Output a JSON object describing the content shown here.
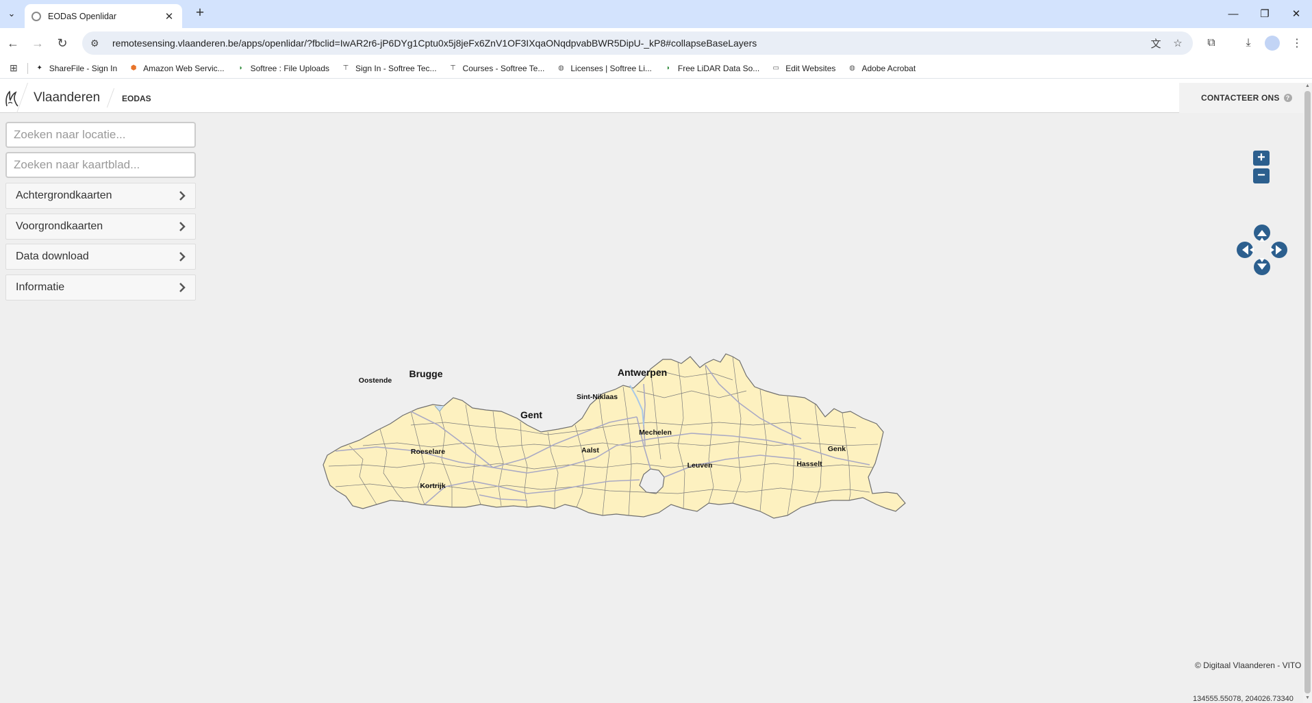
{
  "browser": {
    "tab_title": "EODaS Openlidar",
    "url_host": "remotesensing.vlaanderen.be",
    "url_path": "/apps/openlidar/?fbclid=IwAR2r6-jP6DYg1Cptu0x5j8jeFx6ZnV1OF3IXqaONqdpvabBWR5DipU-_kP8#collapseBaseLayers",
    "bookmarks": [
      {
        "label": "ShareFile - Sign In",
        "icon": "sharefile-icon",
        "color": "#222222"
      },
      {
        "label": "Amazon Web Servic...",
        "icon": "aws-icon",
        "color": "#e8742a"
      },
      {
        "label": "Softree : File Uploads",
        "icon": "softree-icon",
        "color": "#2e8b3a"
      },
      {
        "label": "Sign In - Softree Tec...",
        "icon": "softree-t-icon",
        "color": "#333333"
      },
      {
        "label": "Courses - Softree Te...",
        "icon": "softree-t-icon",
        "color": "#333333"
      },
      {
        "label": "Licenses | Softree Li...",
        "icon": "globe-icon",
        "color": "#555555"
      },
      {
        "label": "Free LiDAR Data So...",
        "icon": "softree-icon",
        "color": "#2e8b3a"
      },
      {
        "label": "Edit Websites",
        "icon": "folder-icon",
        "color": "#555555"
      },
      {
        "label": "Adobe Acrobat",
        "icon": "globe-icon",
        "color": "#555555"
      }
    ]
  },
  "header": {
    "brand": "Vlaanderen",
    "app": "EODAS",
    "contact": "CONTACTEER ONS",
    "help": "?"
  },
  "sidebar": {
    "search_location_placeholder": "Zoeken naar locatie...",
    "search_sheet_placeholder": "Zoeken naar kaartblad...",
    "items": [
      {
        "label": "Achtergrondkaarten"
      },
      {
        "label": "Voorgrondkaarten"
      },
      {
        "label": "Data download"
      },
      {
        "label": "Informatie"
      }
    ]
  },
  "map": {
    "zoom_in": "+",
    "zoom_out": "−",
    "attribution": "© Digitaal Vlaanderen - VITO",
    "coordinates": "134555.55078, 204026.73340",
    "cities": [
      {
        "name": "Brugge",
        "major": true
      },
      {
        "name": "Oostende",
        "major": false
      },
      {
        "name": "Antwerpen",
        "major": true
      },
      {
        "name": "Sint-Niklaas",
        "major": false
      },
      {
        "name": "Gent",
        "major": true
      },
      {
        "name": "Mechelen",
        "major": false
      },
      {
        "name": "Genk",
        "major": false
      },
      {
        "name": "Roeselare",
        "major": false
      },
      {
        "name": "Aalst",
        "major": false
      },
      {
        "name": "Hasselt",
        "major": false
      },
      {
        "name": "Leuven",
        "major": false
      },
      {
        "name": "Kortrijk",
        "major": false
      }
    ],
    "fill_color": "#fdf1c0",
    "border_color": "#6e6e6e",
    "road_color": "#a9a9c4",
    "control_color": "#2c5f8e"
  }
}
